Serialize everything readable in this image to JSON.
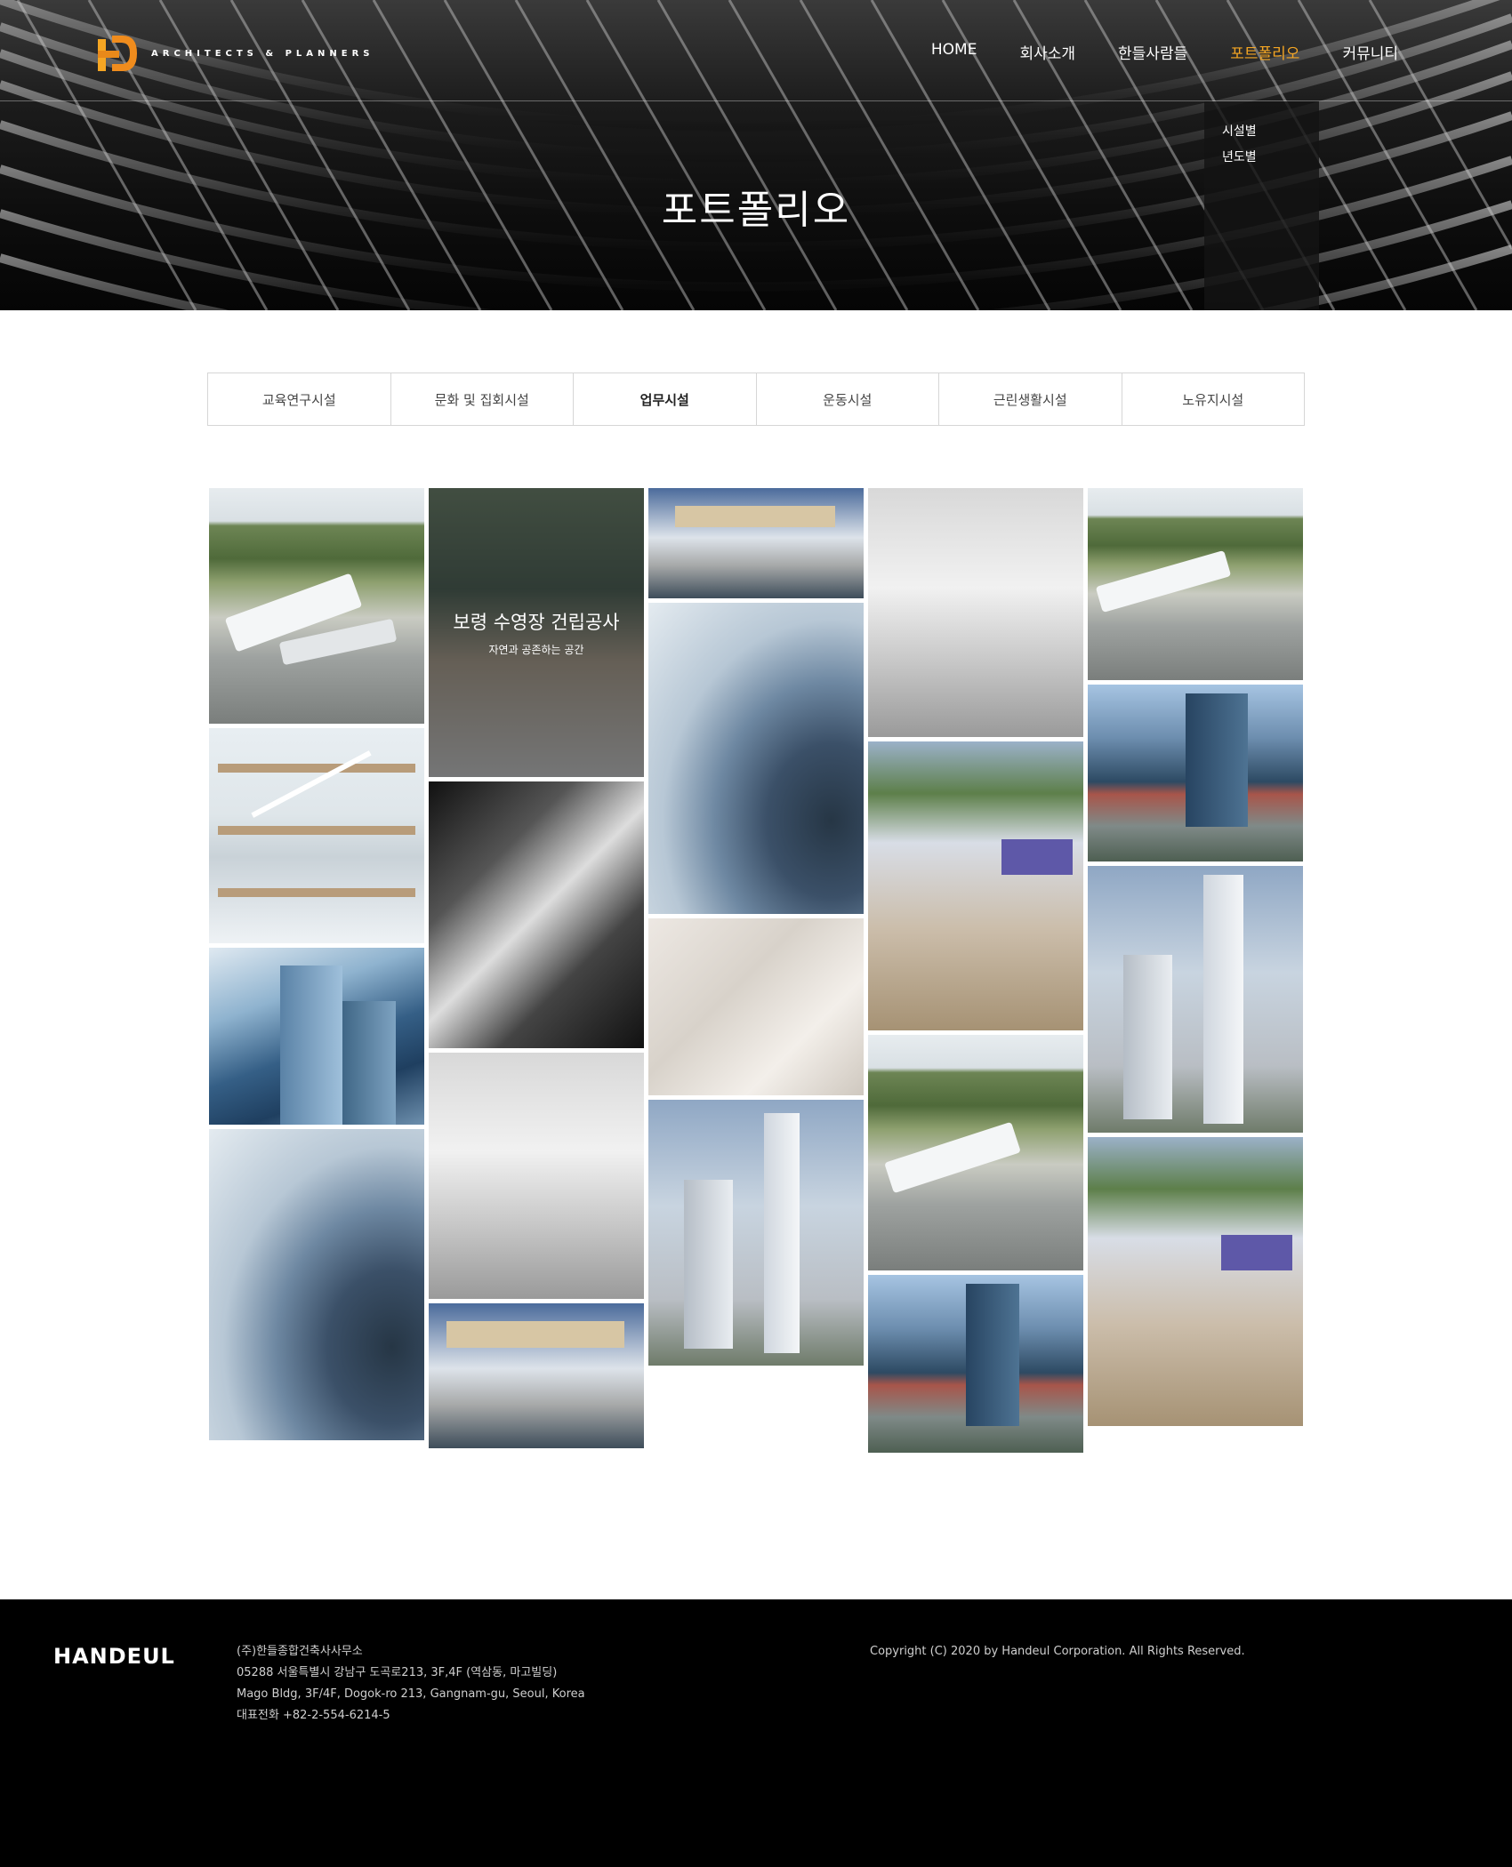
{
  "header": {
    "logo_text": "ARCHITECTS & PLANNERS",
    "nav": [
      {
        "label": "HOME",
        "active": false
      },
      {
        "label": "회사소개",
        "active": false
      },
      {
        "label": "한들사람들",
        "active": false
      },
      {
        "label": "포트폴리오",
        "active": true
      },
      {
        "label": "커뮤니티",
        "active": false
      }
    ],
    "dropdown": [
      "시설별",
      "년도별"
    ],
    "accent_color": "#f5a623"
  },
  "hero": {
    "title": "포트폴리오"
  },
  "tabs": [
    {
      "label": "교육연구시설",
      "active": false
    },
    {
      "label": "문화 및 집회시설",
      "active": false
    },
    {
      "label": "업무시설",
      "active": true
    },
    {
      "label": "운동시설",
      "active": false
    },
    {
      "label": "근린생활시설",
      "active": false
    },
    {
      "label": "노유지시설",
      "active": false
    }
  ],
  "gallery": {
    "hover_item": {
      "title": "보령 수영장 건립공사",
      "subtitle": "자연과 공존하는 공간"
    }
  },
  "footer": {
    "logo": "HANDEUL",
    "company": "(주)한들종합건축사사무소",
    "address_ko": "05288 서울특별시 강남구 도곡로213, 3F,4F (역삼동, 마고빌딩)",
    "address_en": "Mago Bldg, 3F/4F, Dogok-ro 213, Gangnam-gu, Seoul, Korea",
    "phone": "대표전화 +82-2-554-6214-5",
    "copyright": "Copyright (C) 2020 by Handeul Corporation. All Rights Reserved."
  }
}
